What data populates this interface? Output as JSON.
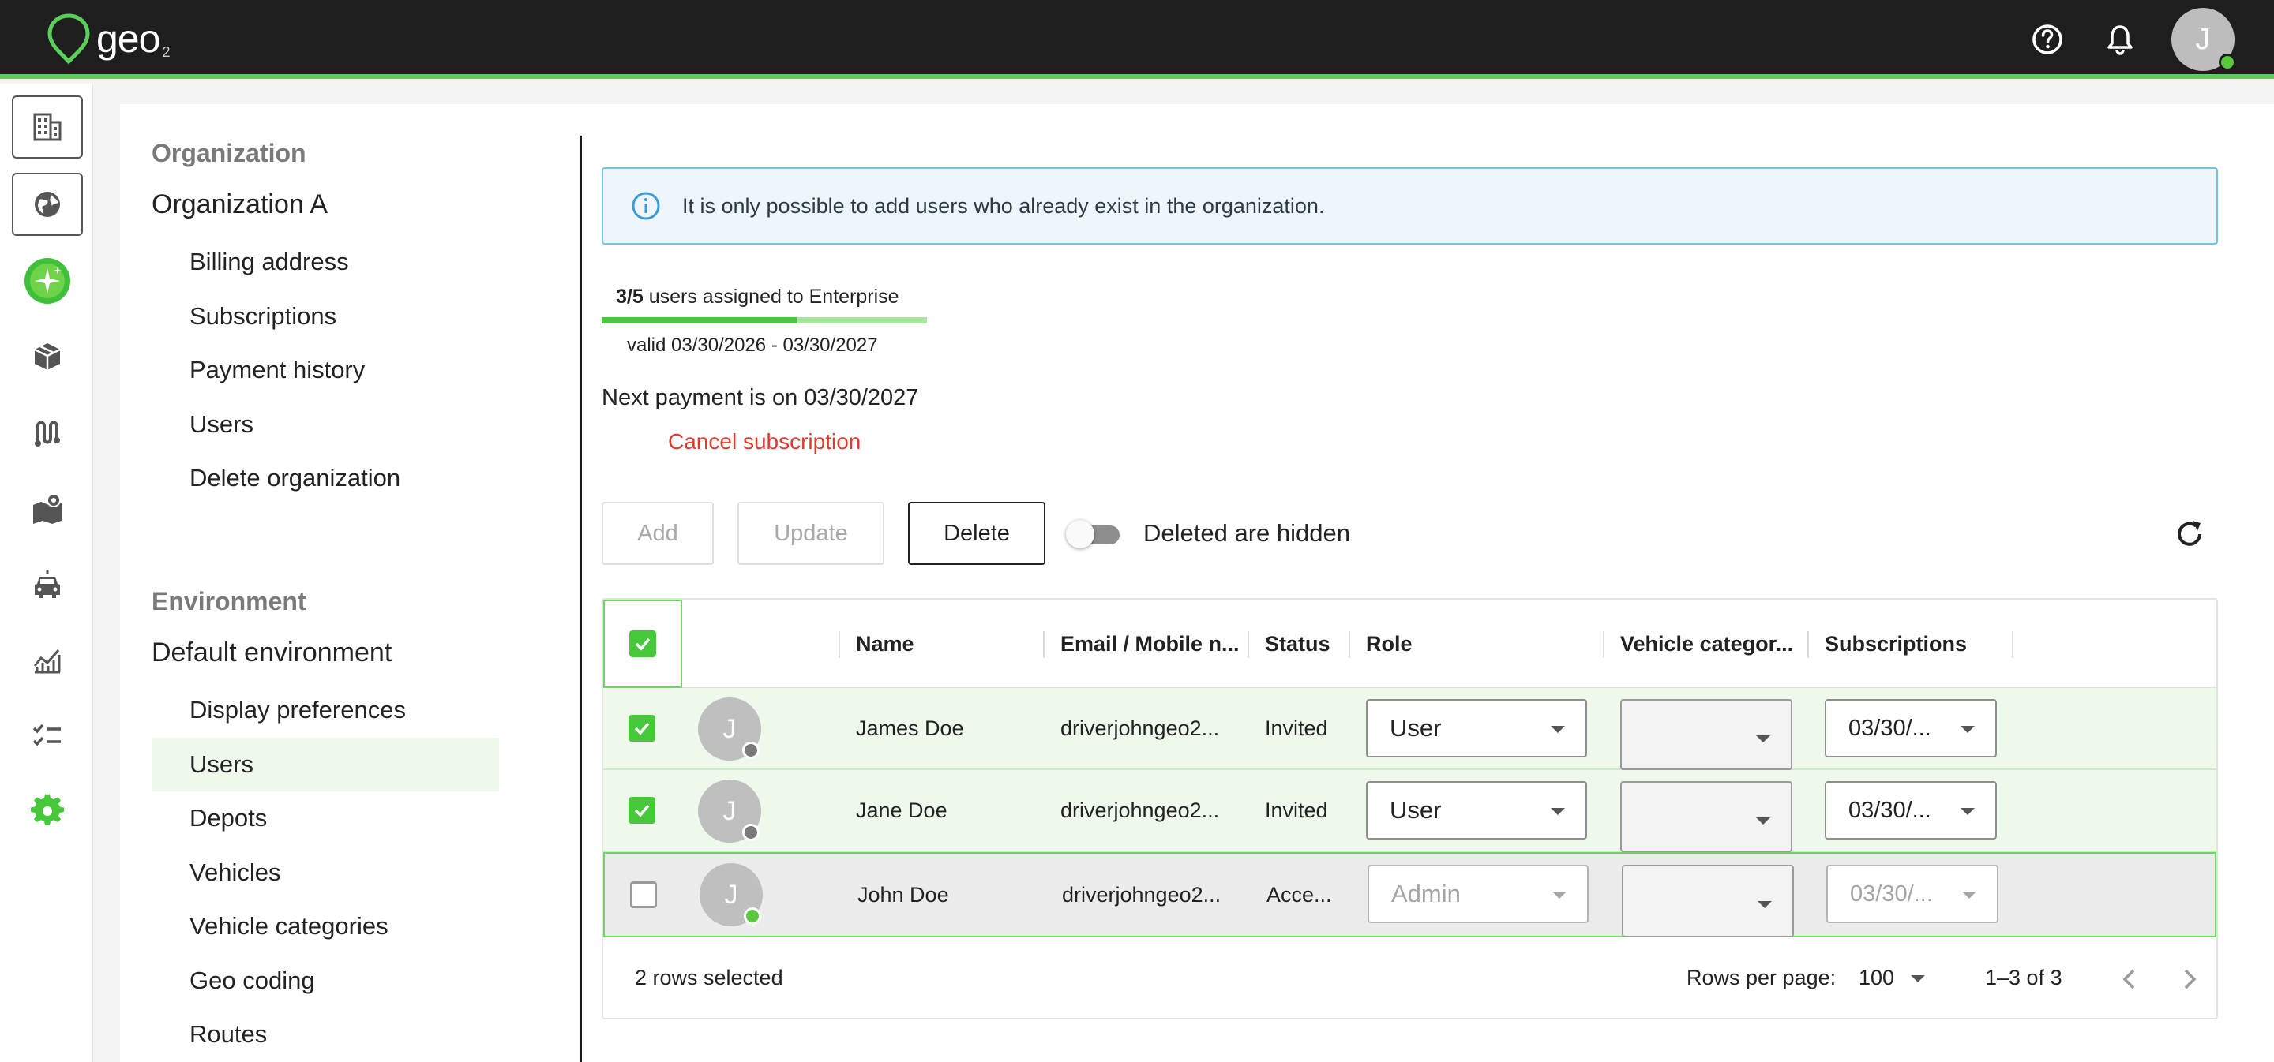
{
  "app": {
    "logo_text": "geo",
    "logo_sub": "2",
    "user_initial": "J"
  },
  "colors": {
    "topbar": "#1e1e1e",
    "accent": "#46c83a",
    "danger": "#e03a2c",
    "info_border": "#73c2e8"
  },
  "topbar": {
    "icons": [
      "help-circle-icon",
      "bell-icon"
    ]
  },
  "rail": {
    "items": [
      "organization-icon",
      "globe-icon",
      "sparkle-icon",
      "package-icon",
      "route-icon",
      "map-icon",
      "car-icon",
      "chart-icon",
      "checklist-icon",
      "gear-icon"
    ]
  },
  "nav": {
    "organization_section": "Organization",
    "organization_name": "Organization A",
    "organization_items": [
      "Billing address",
      "Subscriptions",
      "Payment history",
      "Users",
      "Delete organization"
    ],
    "environment_section": "Environment",
    "environment_name": "Default environment",
    "environment_items": [
      "Display preferences",
      "Users",
      "Depots",
      "Vehicles",
      "Vehicle categories",
      "Geo coding",
      "Routes"
    ],
    "active_item": "Users"
  },
  "banner": {
    "text": "It is only possible to add users who already exist in the organization."
  },
  "subscription": {
    "count": "3/5",
    "label": "users assigned to Enterprise",
    "fill_fraction": 0.6,
    "valid": "valid 03/30/2026 - 03/30/2027",
    "next_payment": "Next payment is on 03/30/2027",
    "cancel": "Cancel subscription"
  },
  "toolbar": {
    "add": "Add",
    "update": "Update",
    "delete": "Delete",
    "toggle_label": "Deleted are hidden"
  },
  "table": {
    "columns": [
      "Name",
      "Email / Mobile n...",
      "Status",
      "Role",
      "Vehicle categor...",
      "Subscriptions"
    ],
    "rows": [
      {
        "initial": "J",
        "name": "James Doe",
        "email": "driverjohngeo2...",
        "status": "Invited",
        "role": "User",
        "vehicle_category": "",
        "subscription": "03/30/...",
        "selected": true,
        "online": false
      },
      {
        "initial": "J",
        "name": "Jane Doe",
        "email": "driverjohngeo2...",
        "status": "Invited",
        "role": "User",
        "vehicle_category": "",
        "subscription": "03/30/...",
        "selected": true,
        "online": false
      },
      {
        "initial": "J",
        "name": "John Doe",
        "email": "driverjohngeo2...",
        "status": "Acce...",
        "role": "Admin",
        "vehicle_category": "",
        "subscription": "03/30/...",
        "selected": false,
        "online": true
      }
    ],
    "footer": {
      "rows_selected": "2 rows selected",
      "rows_per_page_label": "Rows per page:",
      "rows_per_page": "100",
      "range": "1–3 of 3"
    }
  }
}
